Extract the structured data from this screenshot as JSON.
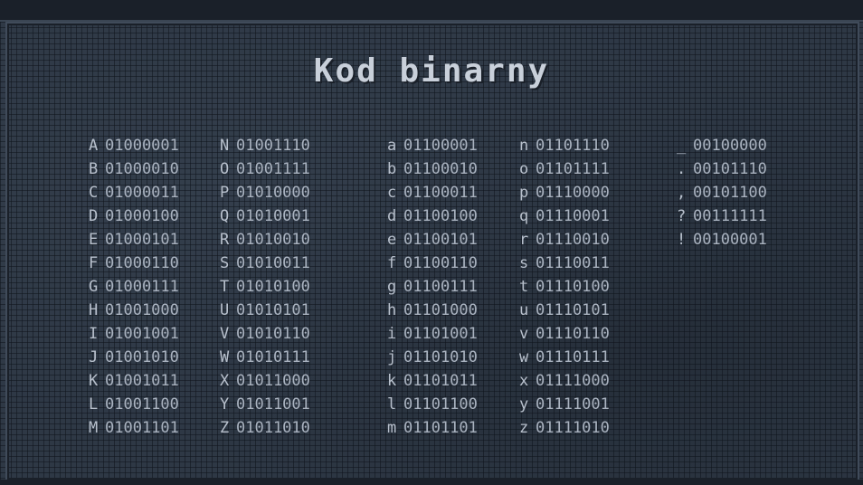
{
  "title": "Kod binarny",
  "columns": [
    [
      {
        "char": "A",
        "code": "01000001"
      },
      {
        "char": "B",
        "code": "01000010"
      },
      {
        "char": "C",
        "code": "01000011"
      },
      {
        "char": "D",
        "code": "01000100"
      },
      {
        "char": "E",
        "code": "01000101"
      },
      {
        "char": "F",
        "code": "01000110"
      },
      {
        "char": "G",
        "code": "01000111"
      },
      {
        "char": "H",
        "code": "01001000"
      },
      {
        "char": "I",
        "code": "01001001"
      },
      {
        "char": "J",
        "code": "01001010"
      },
      {
        "char": "K",
        "code": "01001011"
      },
      {
        "char": "L",
        "code": "01001100"
      },
      {
        "char": "M",
        "code": "01001101"
      }
    ],
    [
      {
        "char": "N",
        "code": "01001110"
      },
      {
        "char": "O",
        "code": "01001111"
      },
      {
        "char": "P",
        "code": "01010000"
      },
      {
        "char": "Q",
        "code": "01010001"
      },
      {
        "char": "R",
        "code": "01010010"
      },
      {
        "char": "S",
        "code": "01010011"
      },
      {
        "char": "T",
        "code": "01010100"
      },
      {
        "char": "U",
        "code": "01010101"
      },
      {
        "char": "V",
        "code": "01010110"
      },
      {
        "char": "W",
        "code": "01010111"
      },
      {
        "char": "X",
        "code": "01011000"
      },
      {
        "char": "Y",
        "code": "01011001"
      },
      {
        "char": "Z",
        "code": "01011010"
      }
    ],
    [
      {
        "char": "a",
        "code": "01100001"
      },
      {
        "char": "b",
        "code": "01100010"
      },
      {
        "char": "c",
        "code": "01100011"
      },
      {
        "char": "d",
        "code": "01100100"
      },
      {
        "char": "e",
        "code": "01100101"
      },
      {
        "char": "f",
        "code": "01100110"
      },
      {
        "char": "g",
        "code": "01100111"
      },
      {
        "char": "h",
        "code": "01101000"
      },
      {
        "char": "i",
        "code": "01101001"
      },
      {
        "char": "j",
        "code": "01101010"
      },
      {
        "char": "k",
        "code": "01101011"
      },
      {
        "char": "l",
        "code": "01101100"
      },
      {
        "char": "m",
        "code": "01101101"
      }
    ],
    [
      {
        "char": "n",
        "code": "01101110"
      },
      {
        "char": "o",
        "code": "01101111"
      },
      {
        "char": "p",
        "code": "01110000"
      },
      {
        "char": "q",
        "code": "01110001"
      },
      {
        "char": "r",
        "code": "01110010"
      },
      {
        "char": "s",
        "code": "01110011"
      },
      {
        "char": "t",
        "code": "01110100"
      },
      {
        "char": "u",
        "code": "01110101"
      },
      {
        "char": "v",
        "code": "01110110"
      },
      {
        "char": "w",
        "code": "01110111"
      },
      {
        "char": "x",
        "code": "01111000"
      },
      {
        "char": "y",
        "code": "01111001"
      },
      {
        "char": "z",
        "code": "01111010"
      }
    ],
    [
      {
        "char": "_",
        "code": "00100000"
      },
      {
        "char": ".",
        "code": "00101110"
      },
      {
        "char": ",",
        "code": "00101100"
      },
      {
        "char": "?",
        "code": "00111111"
      },
      {
        "char": "!",
        "code": "00100001"
      }
    ]
  ]
}
